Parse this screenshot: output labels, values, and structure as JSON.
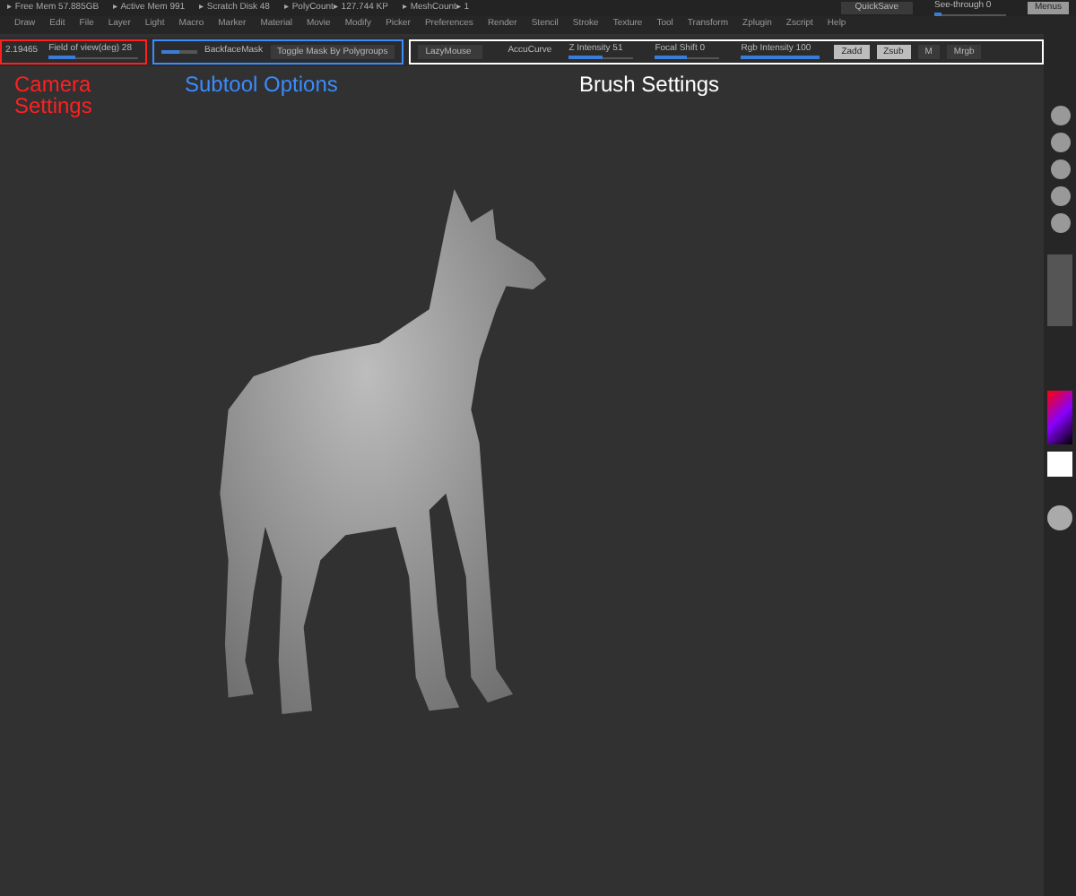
{
  "status_bar": {
    "items": [
      "▸ Free Mem 57.885GB",
      "▸ Active Mem 991",
      "▸ Scratch Disk 48",
      "▸ PolyCount▸ 127.744 KP",
      "▸ MeshCount▸ 1"
    ],
    "quicksave": "QuickSave",
    "see_through": {
      "label": "See-through 0",
      "level": 0.1
    },
    "menus_button": "Menus"
  },
  "menu_bar": [
    "Draw",
    "Edit",
    "File",
    "Layer",
    "Light",
    "Macro",
    "Marker",
    "Material",
    "Movie",
    "Modify",
    "Picker",
    "Preferences",
    "Render",
    "Stencil",
    "Stroke",
    "Texture",
    "Tool",
    "Transform",
    "Zplugin",
    "Zscript",
    "Help"
  ],
  "toolbar": {
    "camera": {
      "value": "2.19465",
      "field_of_view": {
        "label": "Field of view(deg) 28",
        "level": 0.3
      }
    },
    "subtool": {
      "slider": {
        "level": 0.5
      },
      "backface_mask": "BackfaceMask",
      "toggle_mask": "Toggle Mask By Polygroups"
    },
    "brush": {
      "lazymouse": "LazyMouse",
      "accucurve": "AccuCurve",
      "sliders": [
        {
          "label": "Z Intensity 51",
          "level": 0.51
        },
        {
          "label": "Focal Shift 0",
          "level": 0.5
        },
        {
          "label": "Rgb Intensity 100",
          "level": 1
        }
      ],
      "buttons": [
        {
          "label": "Zadd",
          "selected": true
        },
        {
          "label": "Zsub",
          "selected": true
        },
        {
          "label": "M",
          "selected": false
        },
        {
          "label": "Mrgb",
          "selected": false
        }
      ]
    }
  },
  "annotations": [
    {
      "text": "Camera Settings",
      "color": "#ff2020",
      "kind": "camera"
    },
    {
      "text": "Subtool Options",
      "color": "#3a8cff",
      "kind": "subtool"
    },
    {
      "text": "Brush Settings",
      "color": "#ffffff",
      "kind": "brush"
    }
  ]
}
